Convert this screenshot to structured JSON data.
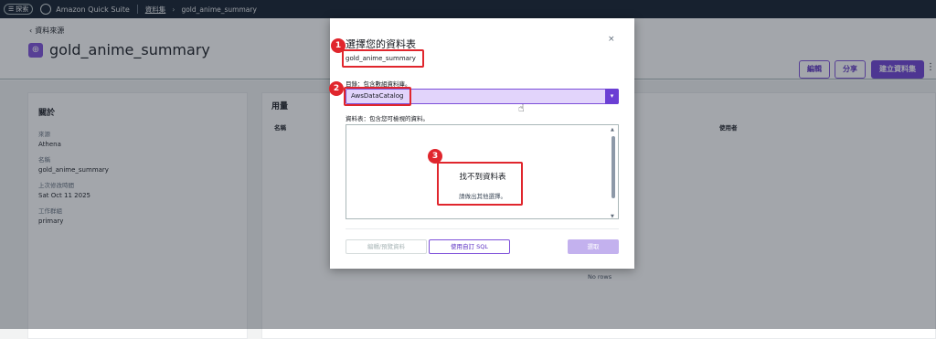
{
  "topnav": {
    "explore_label": "探索",
    "app_title": "Amazon Quick Suite",
    "breadcrumb_datasets": "資料集",
    "breadcrumb_current": "gold_anime_summary"
  },
  "header": {
    "back_label": "資料來源",
    "title": "gold_anime_summary",
    "edit_label": "編輯",
    "share_label": "分享",
    "create_label": "建立資料集"
  },
  "about": {
    "title": "關於",
    "fields": [
      {
        "key": "來源",
        "value": "Athena"
      },
      {
        "key": "名稱",
        "value": "gold_anime_summary"
      },
      {
        "key": "上次修改時間",
        "value": "Sat Oct 11 2025"
      },
      {
        "key": "工作群組",
        "value": "primary"
      }
    ]
  },
  "usage": {
    "title": "用量",
    "col_name": "名稱",
    "col_user": "使用者",
    "no_rows": "No rows"
  },
  "modal": {
    "title": "選擇您的資料表",
    "subtitle": "gold_anime_summary",
    "catalog_label": "目錄：包含數組資料庫。",
    "catalog_value": "AwsDataCatalog",
    "tables_label": "資料表：包含您可檢視的資料。",
    "empty_title": "找不到資料表",
    "empty_subtitle": "請做出其他選擇。",
    "edit_preview_label": "編輯/預覽資料",
    "custom_sql_label": "使用自訂 SQL",
    "select_label": "選取",
    "close_glyph": "×"
  },
  "annotations": {
    "badge_1": "1",
    "badge_2": "2",
    "badge_3": "3",
    "color": "#e0262d"
  },
  "colors": {
    "accent": "#6b3fd4",
    "nav_bg": "#0f1b2a"
  }
}
